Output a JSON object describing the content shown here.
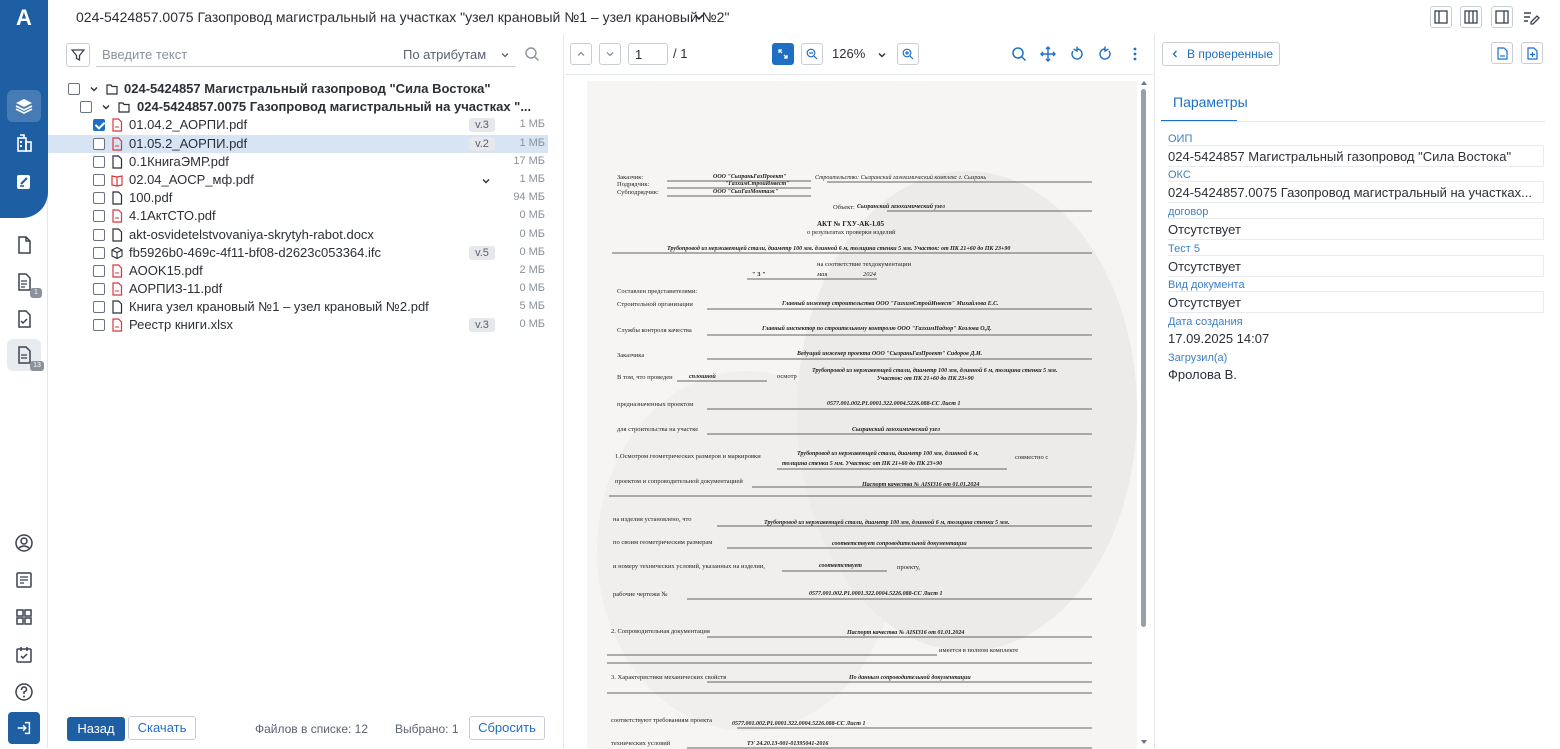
{
  "app": {
    "logo_letter": "A",
    "accent": "#1e5fa3"
  },
  "sidebar": {
    "badges": {
      "b1": "1",
      "b2": "13"
    }
  },
  "header": {
    "title": "024-5424857.0075 Газопровод магистральный на участках \"узел крановый №1 – узел крановый №2\""
  },
  "filter": {
    "placeholder": "Введите текст",
    "attr_label": "По атрибутам"
  },
  "tree": {
    "root": "024-5424857 Магистральный газопровод \"Сила Востока\"",
    "sub": "024-5424857.0075 Газопровод магистральный на участках \"...",
    "files": [
      {
        "name": "01.04.2_АОРПИ.pdf",
        "ver": "v.3",
        "size": "1 МБ"
      },
      {
        "name": "01.05.2_АОРПИ.pdf",
        "ver": "v.2",
        "size": "1 МБ"
      },
      {
        "name": "0.1КнигаЭМР.pdf",
        "ver": "",
        "size": "17 МБ"
      },
      {
        "name": "02.04_АОСР_мф.pdf",
        "ver": "",
        "size": "1 МБ"
      },
      {
        "name": "100.pdf",
        "ver": "",
        "size": "94 МБ"
      },
      {
        "name": "4.1АктСТО.pdf",
        "ver": "",
        "size": "0 МБ"
      },
      {
        "name": "akt-osvidetelstvovaniya-skrytyh-rabot.docx",
        "ver": "",
        "size": "0 МБ"
      },
      {
        "name": "fb5926b0-469c-4f11-bf08-d2623c053364.ifc",
        "ver": "v.5",
        "size": "0 МБ"
      },
      {
        "name": "AOOK15.pdf",
        "ver": "",
        "size": "2 МБ"
      },
      {
        "name": "АОРПИЗ-11.pdf",
        "ver": "",
        "size": "0 МБ"
      },
      {
        "name": "Книга узел крановый №1 – узел крановый №2.pdf",
        "ver": "",
        "size": "5 МБ"
      },
      {
        "name": "Реестр книги.xlsx",
        "ver": "v.3",
        "size": "0 МБ"
      }
    ]
  },
  "footer": {
    "back": "Назад",
    "download": "Скачать",
    "count": "Файлов в списке: 12",
    "selected": "Выбрано: 1",
    "reset": "Сбросить"
  },
  "viewer": {
    "page": "1",
    "total": "/ 1",
    "zoom": "126%"
  },
  "right": {
    "back_label": "В проверенные",
    "tab": "Параметры",
    "params": [
      {
        "label": "ОИП",
        "value": "024-5424857 Магистральный газопровод \"Сила Востока\""
      },
      {
        "label": "ОКС",
        "value": "024-5424857.0075 Газопровод магистральный на участках..."
      },
      {
        "label": "договор",
        "value": "Отсутствует"
      },
      {
        "label": "Тест 5",
        "value": "Отсутствует"
      },
      {
        "label": "Вид документа",
        "value": "Отсутствует"
      },
      {
        "label": "Дата создания",
        "value": "17.09.2025 14:07"
      },
      {
        "label": "Загрузил(а)",
        "value": "Фролова В."
      }
    ]
  },
  "document": {
    "lines": [
      "Заказчик:",
      "ООО \"СызраньГазПроект\"",
      "Строительство: Сызранский газохимический комплекс г. Сызрань",
      "Подрядчик:",
      "\"ГазхимСтройИнвест\"",
      "Субподрядчик:",
      "ООО \"СызГазМонтаж\"",
      "Объект:",
      "Сызранский газохимический узел",
      "АКТ № ГХУ-АК-1.05",
      "о результатах проверки изделий",
      "Трубопровод из нержавеющей стали, диаметр 100 мм. длинной 6 м, толщина стенки 5 мм. Участок: от ПК 21+60 до ПК 23+90",
      "на соответствие техдокументации",
      "\" 3 \"",
      "мая",
      "2024",
      "Составлен представителями:",
      "Строительной организации",
      "Главный инженер строительства ООО \"ГазхимСтройИнвест\" Михайлова Е.С.",
      "Службы контроля качества",
      "Главный инспектор по строительному контролю ООО \"ГазхимНадзор\" Козлова О.Д.",
      "Заказчика",
      "Ведущий инженер проекта ООО \"СызраньГазПроект\" Сидоров Д.И.",
      "В том, что проведен",
      "сплошной",
      "осмотр",
      "Трубопровод из нержавеющей стали, диаметр 100 мм, длинной 6 м, толщина стенки 5 мм.",
      "Участок: от ПК 21+60 до ПК 23+90",
      "предназначенных проектом",
      "0577.001.002.P1.0001.322.0004.5226.088-CC Лист 1",
      "для строительства на участке",
      "Сызранский газохимический узел",
      "1.Осмотром геометрических размеров и маркировки",
      "Трубопровод из нержавеющей стали, диаметр 100 мм, длинной 6 м,",
      "толщина стенки 5 мм. Участок: от ПК 21+60 до ПК 23+90",
      "совместно с",
      "проектом и сопроводительной документацией",
      "Паспорт качества № AISI316 от 01.01.2024",
      "на изделия установлено, что",
      "Трубопровод из нержавеющей стали, диаметр 100 мм, длинной 6 м, толщина стенки 5 мм.",
      "по своим геометрическим размерам",
      "соответствует сопроводительной документации",
      "и номеру технических условий, указанных на изделии,",
      "соответствует",
      "проекту,",
      "рабочие чертежи №",
      "0577.001.002.P1.0001.322.0004.5226.088-CC Лист 1",
      "2. Сопроводительная документация",
      "Паспорт качества № AISI316 от 01.01.2024",
      "имеется в полном комплекте",
      "3. Характеристики механических свойств",
      "По данным сопроводительной документации",
      "соответствуют требованиям проекта",
      "0577.001.002.P1.0001.322.0004.5226.088-CC Лист 1",
      "технических условий",
      "ТУ 24.20.13-001-01395041-2016"
    ]
  }
}
